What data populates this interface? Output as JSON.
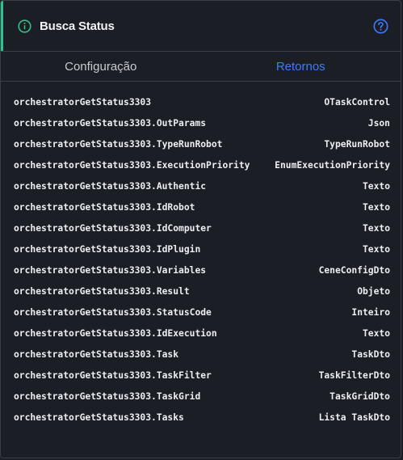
{
  "header": {
    "title": "Busca Status",
    "info_icon": "info-circle-icon",
    "help_icon": "question-circle-icon",
    "accent_color": "#2fc38b",
    "icon_color": "#2fc38b",
    "help_color": "#3d7bff"
  },
  "tabs": [
    {
      "label": "Configuração",
      "active": false
    },
    {
      "label": "Retornos",
      "active": true
    }
  ],
  "returns": [
    {
      "name": "orchestratorGetStatus3303",
      "type": "OTaskControl"
    },
    {
      "name": "orchestratorGetStatus3303.OutParams",
      "type": "Json"
    },
    {
      "name": "orchestratorGetStatus3303.TypeRunRobot",
      "type": "TypeRunRobot"
    },
    {
      "name": "orchestratorGetStatus3303.ExecutionPriority",
      "type": "EnumExecutionPriority"
    },
    {
      "name": "orchestratorGetStatus3303.Authentic",
      "type": "Texto"
    },
    {
      "name": "orchestratorGetStatus3303.IdRobot",
      "type": "Texto"
    },
    {
      "name": "orchestratorGetStatus3303.IdComputer",
      "type": "Texto"
    },
    {
      "name": "orchestratorGetStatus3303.IdPlugin",
      "type": "Texto"
    },
    {
      "name": "orchestratorGetStatus3303.Variables",
      "type": "CeneConfigDto"
    },
    {
      "name": "orchestratorGetStatus3303.Result",
      "type": "Objeto"
    },
    {
      "name": "orchestratorGetStatus3303.StatusCode",
      "type": "Inteiro"
    },
    {
      "name": "orchestratorGetStatus3303.IdExecution",
      "type": "Texto"
    },
    {
      "name": "orchestratorGetStatus3303.Task",
      "type": "TaskDto"
    },
    {
      "name": "orchestratorGetStatus3303.TaskFilter",
      "type": "TaskFilterDto"
    },
    {
      "name": "orchestratorGetStatus3303.TaskGrid",
      "type": "TaskGridDto"
    },
    {
      "name": "orchestratorGetStatus3303.Tasks",
      "type": "Lista TaskDto"
    }
  ]
}
